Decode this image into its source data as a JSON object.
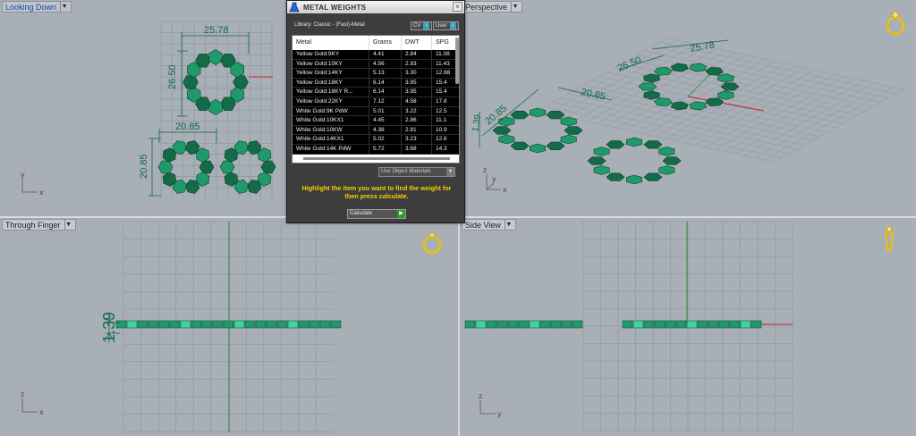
{
  "viewports": {
    "top_left": {
      "title": "Looking Down",
      "axes": {
        "y": "y",
        "x": "x"
      }
    },
    "top_right": {
      "title": "Perspective",
      "axes": {
        "z": "z",
        "y": "y",
        "x": "x"
      }
    },
    "bottom_left": {
      "title": "Through Finger",
      "axes": {
        "z": "z",
        "x": "x"
      }
    },
    "bottom_right": {
      "title": "Side View",
      "axes": {
        "z": "z",
        "y": "y"
      }
    }
  },
  "dimensions": {
    "top_left": {
      "width_top": "25.78",
      "height_side": "26.50",
      "width_bottom": "20.85",
      "height_bottom": "20.85"
    },
    "top_right": {
      "d1": "26.50",
      "d2": "25.78",
      "d3": "20.85",
      "d4": "20.85",
      "d5": "1.39"
    },
    "bottom_left": {
      "thickness": "1.39"
    }
  },
  "dialog": {
    "title": "METAL WEIGHTS",
    "library_label": "Library: Classic - (Fast)-Metal",
    "cv_label": "CV",
    "user_label": "User",
    "columns": [
      "Metal",
      "Grams",
      "DWT",
      "SPG"
    ],
    "rows": [
      [
        "Yellow Gold:9KY",
        "4.41",
        "2.84",
        "11.08"
      ],
      [
        "Yellow Gold:10KY",
        "4.56",
        "2.93",
        "11.43"
      ],
      [
        "Yellow Gold:14KY",
        "5.13",
        "3.30",
        "12.88"
      ],
      [
        "Yellow Gold:18KY",
        "6.14",
        "3.95",
        "15.4"
      ],
      [
        "Yellow Gold:18KY R...",
        "6.14",
        "3.95",
        "15.4"
      ],
      [
        "Yellow Gold:22KY",
        "7.12",
        "4.58",
        "17.8"
      ],
      [
        "White Gold:9K PdW",
        "5.01",
        "3.22",
        "12.5"
      ],
      [
        "White Gold:10KX1",
        "4.45",
        "2.86",
        "11.1"
      ],
      [
        "White Gold:10KW",
        "4.38",
        "2.81",
        "10.9"
      ],
      [
        "White Gold:14KX1",
        "5.02",
        "3.23",
        "12.6"
      ],
      [
        "White Gold:14K PdW",
        "5.72",
        "3.68",
        "14.3"
      ]
    ],
    "use_materials_label": "Use Object Materials",
    "hint": "Highlight the item you want to find the weight for then press calculate.",
    "calculate_label": "Calculate"
  },
  "colors": {
    "viewport_bg": "#a9afb7",
    "jewel_green": "#1f9a6a",
    "dimension_green": "#0f6a46",
    "hint_yellow": "#f5d000",
    "ring_icon": "#f0c000"
  },
  "icons": {
    "dialog_logo": "flask-icon",
    "close": "close-icon",
    "ring": "ring-icon"
  }
}
